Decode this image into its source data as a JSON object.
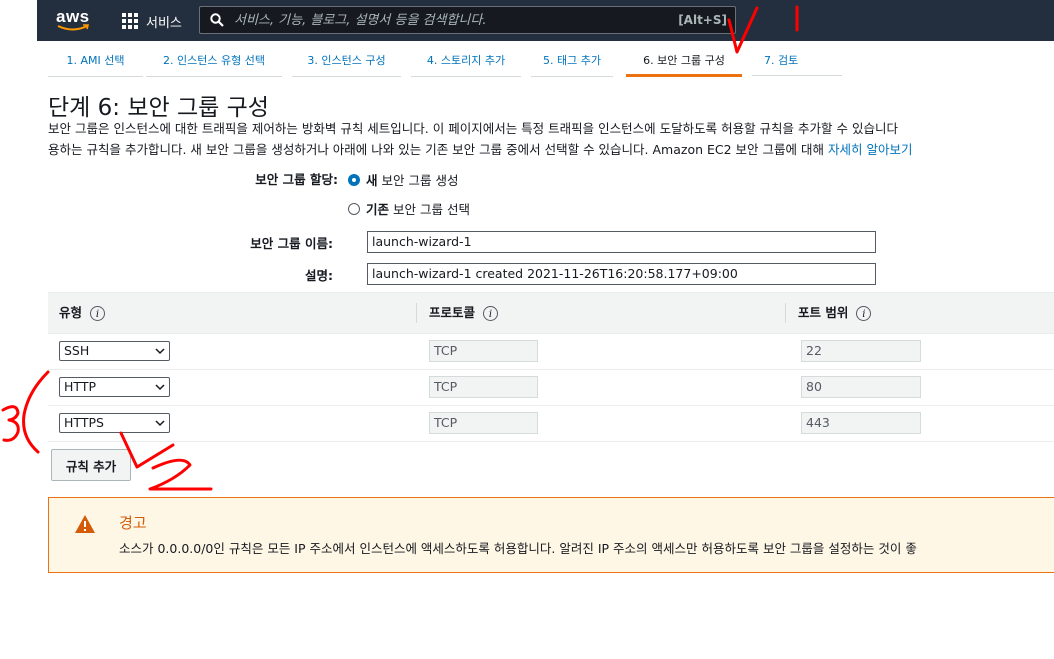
{
  "header": {
    "logo": "aws",
    "services_label": "서비스",
    "search_placeholder": "서비스, 기능, 블로그, 설명서 등을 검색합니다.",
    "search_shortcut": "[Alt+S]"
  },
  "tabs": [
    {
      "label": "1. AMI 선택"
    },
    {
      "label": "2. 인스턴스 유형 선택"
    },
    {
      "label": "3. 인스턴스 구성"
    },
    {
      "label": "4. 스토리지 추가"
    },
    {
      "label": "5. 태그 추가"
    },
    {
      "label": "6. 보안 그룹 구성"
    },
    {
      "label": "7. 검토"
    }
  ],
  "active_tab": "6. 보안 그룹 구성",
  "page": {
    "title": "단계 6: 보안 그룹 구성",
    "description_line1": "보안 그룹은 인스턴스에 대한 트래픽을 제어하는 방화벽 규칙 세트입니다. 이 페이지에서는 특정 트래픽을 인스턴스에 도달하도록 허용할 규칙을 추가할 수 있습니다",
    "description_line2": "용하는 규칙을 추가합니다. 새 보안 그룹을 생성하거나 아래에 나와 있는 기존 보안 그룹 중에서 선택할 수 있습니다. Amazon EC2 보안 그룹에 대해 ",
    "learn_more": "자세히 알아보기"
  },
  "form": {
    "assign_label": "보안 그룹 할당:",
    "option_new_bold": "새",
    "option_new_rest": "보안 그룹 생성",
    "option_existing_bold": "기존",
    "option_existing_rest": "보안 그룹 선택",
    "selected_option": "new",
    "name_label": "보안 그룹 이름:",
    "name_value": "launch-wizard-1",
    "desc_label": "설명:",
    "desc_value": "launch-wizard-1 created 2021-11-26T16:20:58.177+09:00"
  },
  "rules": {
    "columns": [
      "유형",
      "프로토콜",
      "포트 범위"
    ],
    "rows": [
      {
        "type": "SSH",
        "protocol": "TCP",
        "port": "22"
      },
      {
        "type": "HTTP",
        "protocol": "TCP",
        "port": "80"
      },
      {
        "type": "HTTPS",
        "protocol": "TCP",
        "port": "443"
      }
    ],
    "add_rule_label": "규칙 추가"
  },
  "warning": {
    "title": "경고",
    "text": "소스가 0.0.0.0/0인 규칙은 모든 IP 주소에서 인스턴스에 액세스하도록 허용합니다. 알려진 IP 주소의 액세스만 허용하도록 보안 그룹을 설정하는 것이 좋"
  },
  "colors": {
    "nav_bg": "#232f3e",
    "link": "#0073bb",
    "accent": "#ec7211",
    "warning_bg": "#fff7e6",
    "annotation": "#ff0000"
  }
}
